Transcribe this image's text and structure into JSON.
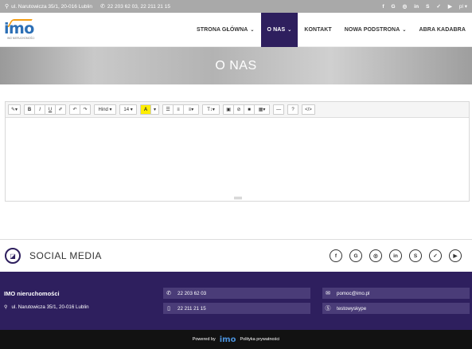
{
  "topbar": {
    "address": "ul. Narutowicza 35/1, 20-016 Lublin",
    "phones": "22 203 62 03, 22 211 21 15",
    "socials": [
      "f",
      "G",
      "◎",
      "in",
      "S",
      "✓",
      "▶"
    ],
    "lang": "pl"
  },
  "logo": {
    "text": "imo",
    "sub": "IMO NIERUCHOMOŚCI"
  },
  "nav": [
    {
      "label": "STRONA GŁÓWNA",
      "dropdown": true,
      "active": false
    },
    {
      "label": "O NAS",
      "dropdown": true,
      "active": true
    },
    {
      "label": "KONTAKT",
      "dropdown": false,
      "active": false
    },
    {
      "label": "NOWA PODSTRONA",
      "dropdown": true,
      "active": false
    },
    {
      "label": "ABRA KADABRA",
      "dropdown": false,
      "active": false
    }
  ],
  "hero": {
    "title": "O NAS"
  },
  "toolbar": {
    "magic": "✎▾",
    "bold": "B",
    "italic": "I",
    "underline": "U",
    "eraser": "✐",
    "undo": "↶",
    "redo": "↷",
    "font": "Hind ▾",
    "size": "14 ▾",
    "color_a": "A",
    "color_caret": "▾",
    "ul": "☰",
    "ol": "≡",
    "align": "≡▾",
    "text": "T↕▾",
    "image": "▣",
    "link": "⊘",
    "video": "■",
    "table": "▦▾",
    "hr": "—",
    "help": "?",
    "code": "</>"
  },
  "social": {
    "badge": "◪",
    "title": "SOCIAL MEDIA",
    "icons": [
      "f",
      "G",
      "◎",
      "in",
      "S",
      "✓",
      "▶"
    ]
  },
  "footer": {
    "company": "IMO nieruchomości",
    "address": "ul. Narutowicza 35/1, 20-016 Lublin",
    "phone1": "22 203 62 03",
    "phone2": "22 211 21 15",
    "email": "pomoc@imo.pl",
    "skype": "testowyskype"
  },
  "bottom": {
    "powered": "Powered by",
    "brand": "imo",
    "privacy": "Polityka prywatności"
  },
  "colors": {
    "brand": "#2e1f5e",
    "logo": "#2c6fb5",
    "accent": "#f39c12"
  }
}
